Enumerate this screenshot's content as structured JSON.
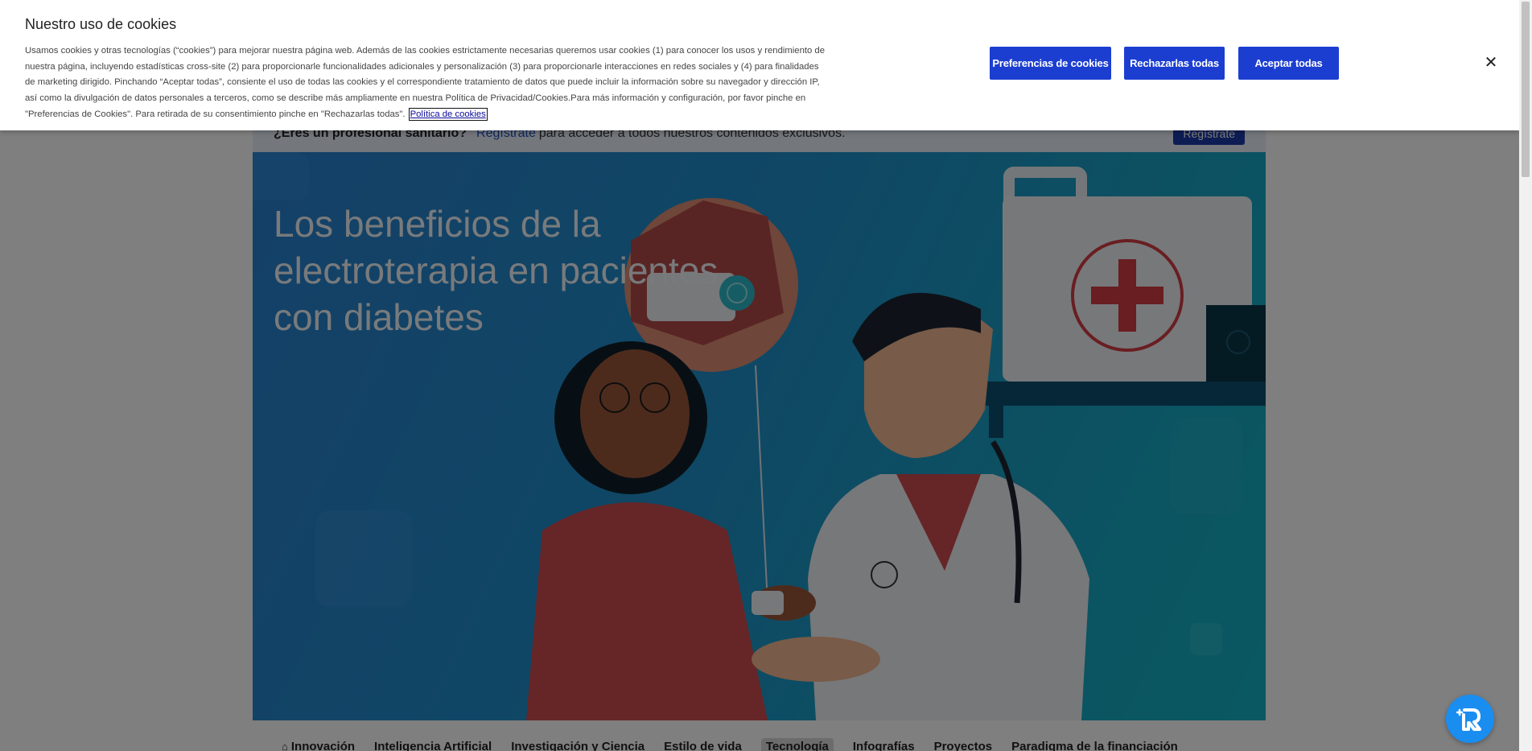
{
  "cookie_banner": {
    "title": "Nuestro uso de cookies",
    "description": "Usamos cookies y otras tecnologías (“cookies”) para mejorar nuestra página web. Además de las cookies estrictamente necesarias queremos usar cookies (1) para conocer los usos y rendimiento de nuestra página, incluyendo estadísticas cross-site (2) para proporcionarle funcionalidades adicionales y personalización (3) para proporcionarle interacciones en redes sociales y (4) para finalidades de marketing dirigido. Pinchando “Aceptar todas”, consiente el uso de todas las cookies y el correspondiente tratamiento de datos que puede incluir la información sobre su navegador y dirección IP, así como la divulgación de datos personales a terceros, como se describe más ampliamente en nuestra Política de Privacidad/Cookies.Para más información y configuración, por favor pinche en \"Preferencias de Cookies\". Para retirada de su consentimiento pinche en \"Rechazarlas todas\".",
    "policy_link": "Política de cookies",
    "btn_prefs": "Preferencias de cookies",
    "btn_reject": "Rechazarlas todas",
    "btn_accept": "Aceptar todas",
    "close_symbol": "✕"
  },
  "hcp_bar": {
    "question": "¿Eres un profesional sanitario?",
    "link": "Regístrate",
    "text": "para acceder a todos nuestros contenidos exclusivos.",
    "button": "Regístrate"
  },
  "hero": {
    "title": "Los beneficios de la electroterapia en pacientes con diabetes"
  },
  "nav": {
    "items": [
      {
        "label": "Innovación",
        "icon": "home-icon"
      },
      {
        "label": "Inteligencia Artificial"
      },
      {
        "label": "Investigación y Ciencia"
      },
      {
        "label": "Estilo de vida"
      },
      {
        "label": "Tecnología",
        "active": true
      },
      {
        "label": "Infografías"
      },
      {
        "label": "Proyectos"
      },
      {
        "label": "Paradigma de la financiación"
      }
    ]
  },
  "colors": {
    "brand_blue": "#1b3ed1",
    "fab_blue": "#1a8df0",
    "hero_gradient_start": "#2a80cf",
    "hero_gradient_end": "#14b1c2"
  }
}
